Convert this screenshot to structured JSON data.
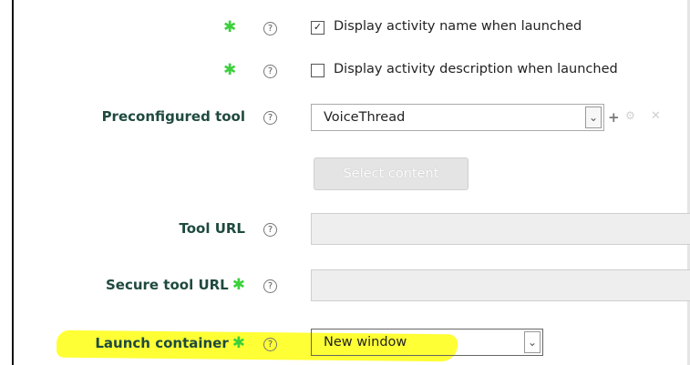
{
  "form": {
    "row1": {
      "checkbox_mark": "✓",
      "label": "Display activity name when launched",
      "checked": true
    },
    "row2": {
      "checkbox_mark": "",
      "label": "Display activity description when launched",
      "checked": false
    },
    "preconfigured": {
      "label": "Preconfigured tool",
      "value": "VoiceThread"
    },
    "select_content": {
      "label": "Select content"
    },
    "tool_url": {
      "label": "Tool URL",
      "value": ""
    },
    "secure_tool_url": {
      "label": "Secure tool URL",
      "value": ""
    },
    "launch_container": {
      "label": "Launch container",
      "value": "New window"
    }
  },
  "icons": {
    "required": "✱",
    "help": "?",
    "dropdown": "⌄",
    "add": "+",
    "gear": "⚙",
    "delete": "✕"
  },
  "colors": {
    "label": "#1f4a3f",
    "required": "#3bd13b",
    "highlight": "#ffff35"
  }
}
